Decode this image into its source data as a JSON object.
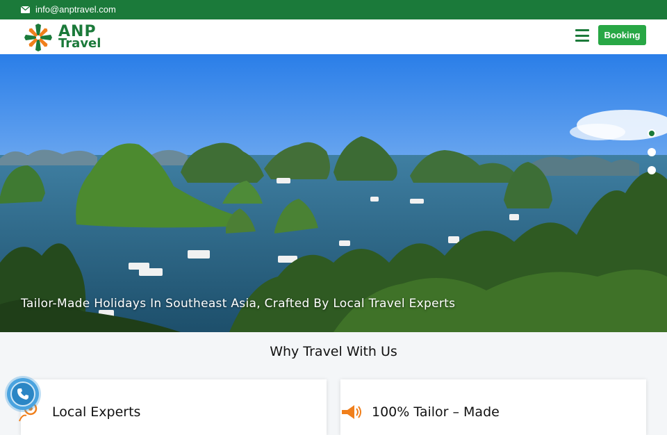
{
  "topbar": {
    "email": "info@anptravel.com",
    "icon": "envelope-icon"
  },
  "header": {
    "logo": {
      "line1": "ANP",
      "line2": "Travel"
    },
    "menu_icon": "hamburger-icon",
    "booking_label": "Booking"
  },
  "hero": {
    "caption": "Tailor-Made Holidays In Southeast Asia, Crafted By Local Travel Experts",
    "slides": 3,
    "active_slide": 1
  },
  "why": {
    "title": "Why Travel With Us",
    "cards": [
      {
        "title": "Local Experts",
        "icon": "map-pin-icon"
      },
      {
        "title": "100% Tailor – Made",
        "icon": "megaphone-icon"
      }
    ]
  },
  "colors": {
    "brand": "#1b7a3a",
    "accent": "#28a745",
    "orange": "#f07f1b"
  },
  "call_button": {
    "icon": "phone-icon"
  }
}
